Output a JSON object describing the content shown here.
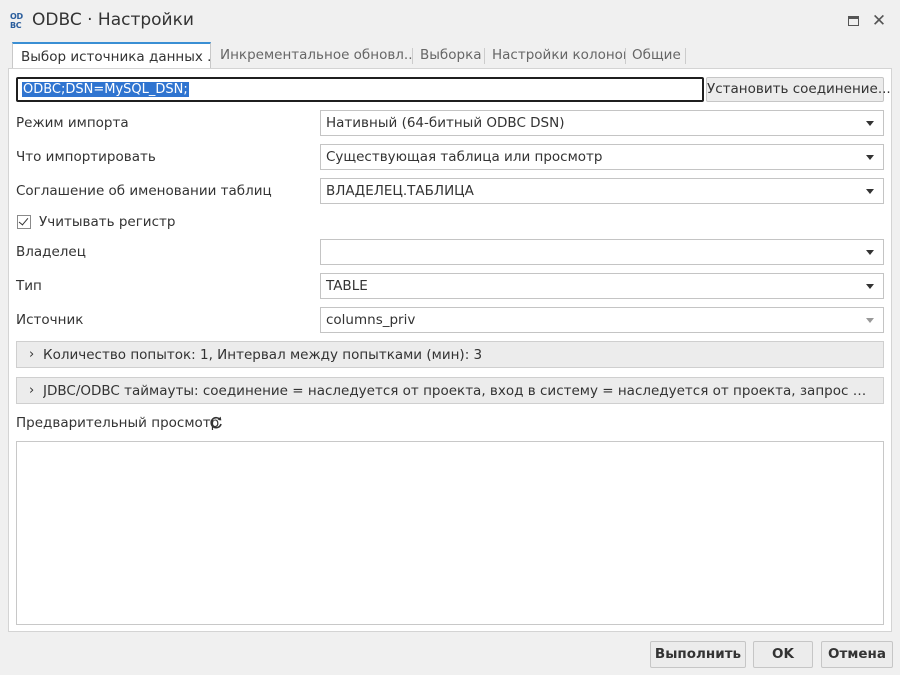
{
  "window": {
    "logo_text": "OD BC",
    "title": "ODBC · Настройки"
  },
  "tabs": [
    {
      "label": "Выбор источника данных ..."
    },
    {
      "label": "Инкрементальное обновл..."
    },
    {
      "label": "Выборка"
    },
    {
      "label": "Настройки колонок"
    },
    {
      "label": "Общие"
    }
  ],
  "connection": {
    "value": "ODBC;DSN=MySQL_DSN;",
    "connect_button": "Установить соединение..."
  },
  "fields": {
    "import_mode": {
      "label": "Режим импорта",
      "value": "Нативный (64-битный ODBC DSN)"
    },
    "what_to_import": {
      "label": "Что импортировать",
      "value": "Существующая таблица или просмотр"
    },
    "naming": {
      "label": "Соглашение об именовании таблиц",
      "value": "ВЛАДЕЛЕЦ.ТАБЛИЦА"
    },
    "case_sensitive": {
      "label": "Учитывать регистр",
      "checked": true
    },
    "owner": {
      "label": "Владелец",
      "value": ""
    },
    "type": {
      "label": "Тип",
      "value": "TABLE"
    },
    "source": {
      "label": "Источник",
      "value": "columns_priv"
    }
  },
  "retries": {
    "text": "Количество попыток: 1, Интервал между попытками (мин): 3"
  },
  "timeouts": {
    "text": "JDBC/ODBC таймауты: соединение = наследуется от проекта, вход в систему = наследуется от проекта, запрос = наследуется от п..."
  },
  "preview": {
    "label": "Предварительный просмотр"
  },
  "footer": {
    "run": "Выполнить",
    "ok": "OK",
    "cancel": "Отмена"
  },
  "colors": {
    "accent": "#3a8fd4",
    "selection": "#2f74d0",
    "logo": "#2a5d9c"
  }
}
